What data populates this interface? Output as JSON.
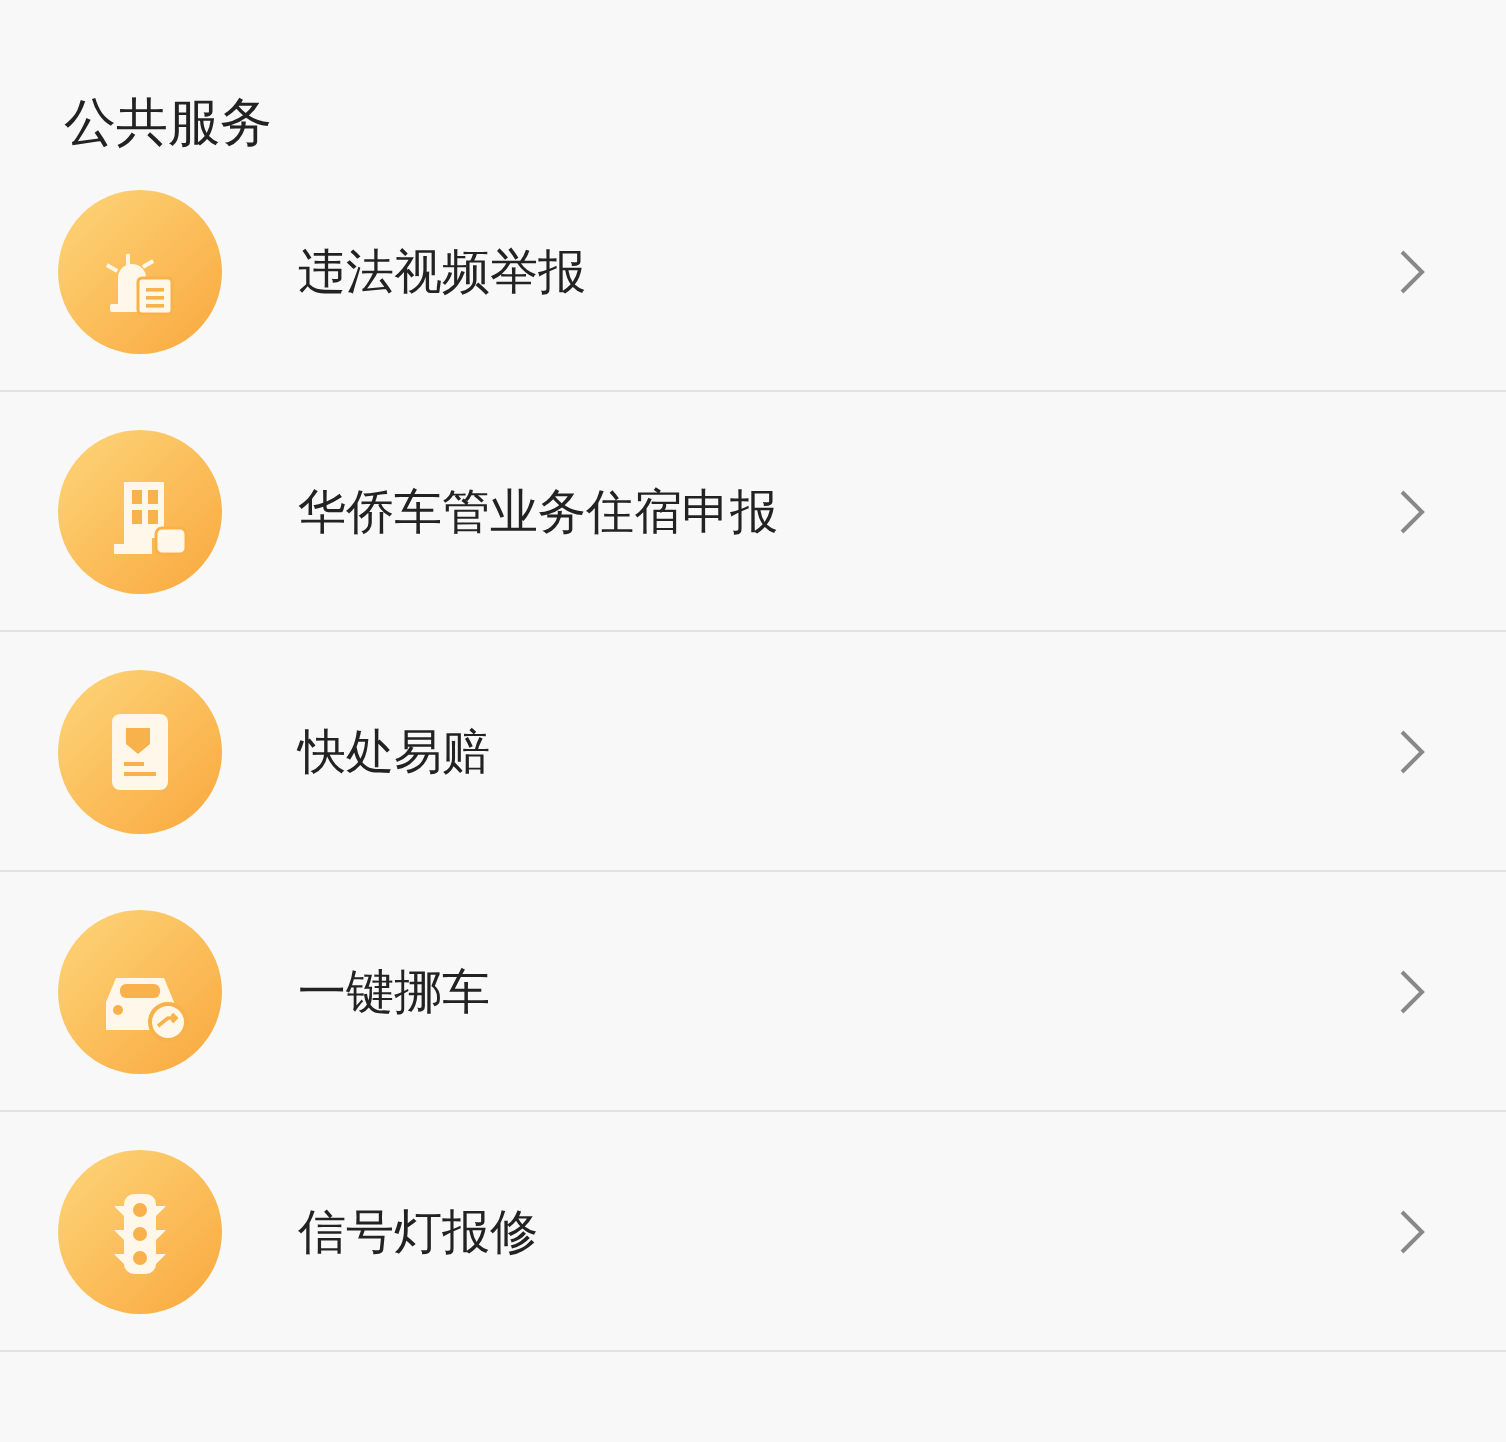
{
  "section": {
    "title": "公共服务"
  },
  "items": [
    {
      "label": "违法视频举报",
      "kind": "report"
    },
    {
      "label": "华侨车管业务住宿申报",
      "kind": "lodging"
    },
    {
      "label": "快处易赔",
      "kind": "claim"
    },
    {
      "label": "一键挪车",
      "kind": "car"
    },
    {
      "label": "信号灯报修",
      "kind": "light"
    }
  ]
}
